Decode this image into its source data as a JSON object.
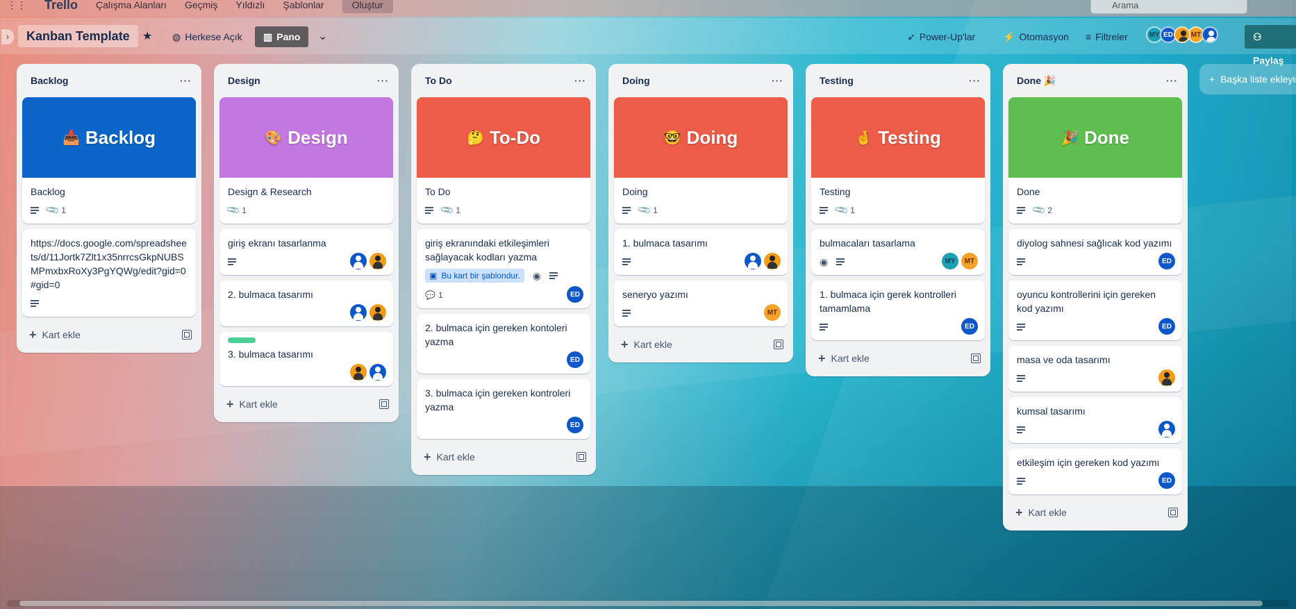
{
  "topnav": {
    "logo": "Trello",
    "items": [
      "Çalışma Alanları",
      "Geçmiş",
      "Yıldızlı",
      "Şablonlar"
    ],
    "create": "Oluştur",
    "search_placeholder": "Arama"
  },
  "board": {
    "title": "Kanban Template",
    "visibility": "Herkese Açık",
    "view": "Pano",
    "powerups": "Power-Up'lar",
    "automation": "Otomasyon",
    "filters": "Filtreler",
    "share": "Paylaş",
    "members": [
      "MY",
      "ED",
      "",
      "MT",
      ""
    ]
  },
  "lists": [
    {
      "name": "Backlog",
      "cover": {
        "emoji": "📥",
        "title": "Backlog",
        "color": "#0c66c9"
      },
      "cover_card": {
        "title": "Backlog",
        "attachments": "1"
      },
      "cards": [
        {
          "title": "https://docs.google.com/spreadsheets/d/11Jortk7Zlt1x35nrrcsGkpNUBSMPmxbxRoXy3PgYQWg/edit?gid=0#gid=0"
        }
      ],
      "add": "Kart ekle"
    },
    {
      "name": "Design",
      "cover": {
        "emoji": "🎨",
        "title": "Design",
        "color": "#c377e0"
      },
      "cover_card": {
        "title": "Design & Research",
        "attachments": "1"
      },
      "cards": [
        {
          "title": "giriş ekranı tasarlanma"
        },
        {
          "title": "2. bulmaca tasarımı"
        },
        {
          "title": "3. bulmaca tasarımı"
        }
      ],
      "add": "Kart ekle"
    },
    {
      "name": "To Do",
      "cover": {
        "emoji": "🤔",
        "title": "To-Do",
        "color": "#ed5c48"
      },
      "cover_card": {
        "title": "To Do",
        "attachments": "1"
      },
      "cards": [
        {
          "title": "giriş ekranındaki etkileşimleri sağlayacak kodları yazma",
          "template_badge": "Bu kart bir şablondur.",
          "comments": "1"
        },
        {
          "title": "2. bulmaca için gereken kontoleri yazma"
        },
        {
          "title": "3. bulmaca için gereken kontroleri yazma"
        }
      ],
      "add": "Kart ekle"
    },
    {
      "name": "Doing",
      "cover": {
        "emoji": "🤓",
        "title": "Doing",
        "color": "#ed5c48"
      },
      "cover_card": {
        "title": "Doing",
        "attachments": "1"
      },
      "cards": [
        {
          "title": "1. bulmaca tasarımı"
        },
        {
          "title": "seneryo yazımı"
        }
      ],
      "add": "Kart ekle"
    },
    {
      "name": "Testing",
      "cover": {
        "emoji": "🤞",
        "title": "Testing",
        "color": "#ed5c48"
      },
      "cover_card": {
        "title": "Testing",
        "attachments": "1"
      },
      "cards": [
        {
          "title": "bulmacaları tasarlama"
        },
        {
          "title": "1. bulmaca için gerek kontrolleri tamamlama"
        }
      ],
      "add": "Kart ekle"
    },
    {
      "name": "Done 🎉",
      "cover": {
        "emoji": "🎉",
        "title": "Done",
        "color": "#5fbe50"
      },
      "cover_card": {
        "title": "Done",
        "attachments": "2"
      },
      "cards": [
        {
          "title": "diyolog sahnesi sağlıcak kod yazımı"
        },
        {
          "title": "oyuncu kontrollerini için gereken kod yazımı"
        },
        {
          "title": "masa ve oda tasarımı"
        },
        {
          "title": "kumsal tasarımı"
        },
        {
          "title": "etkileşim için gereken kod yazımı"
        }
      ],
      "add": "Kart ekle"
    }
  ],
  "add_list": "Başka liste ekleyin",
  "avatars": {
    "MY": "MY",
    "ED": "ED",
    "MT": "MT"
  }
}
